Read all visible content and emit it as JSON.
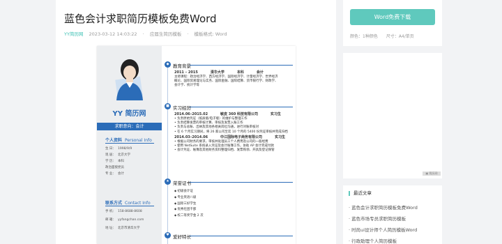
{
  "article": {
    "title": "蓝色会计求职简历模板免费Word",
    "site": "YY简历网",
    "date": "2023-03-12 14:03:22",
    "category": "应届生简历模板",
    "format": "模板格式: Word"
  },
  "resume": {
    "name": "YY 简历网",
    "intent": "求职意向：会计",
    "personal_title": "个人资料",
    "personal_en": "Personal Info",
    "personal": [
      {
        "k": "生    日：",
        "v": "1998/9/9"
      },
      {
        "k": "现    居：",
        "v": "北京大学"
      },
      {
        "k": "学    历：",
        "v": "本科"
      },
      {
        "k": "政治面貌：",
        "v": "党员"
      },
      {
        "k": "专    业：",
        "v": "会计"
      }
    ],
    "contact_title": "联系方式",
    "contact_en": "Contact Info",
    "contact": [
      {
        "k": "手    机：",
        "v": "158-8688-8608"
      },
      {
        "k": "邮    箱：",
        "v": "yyfangchan.com"
      },
      {
        "k": "地    址：",
        "v": "北京市清华大学"
      }
    ],
    "edu_title": "教育背景",
    "edu_period": "2011 – 2015",
    "edu_school": "清华大学",
    "edu_degree": "本科",
    "edu_major": "会计",
    "edu_desc": [
      "主修课程：政治经济学、西方经济学、国际经济学、计量经济学、世界经济",
      "概论、国际贸易理论与实务、国际金融、国际结算、货币银行学、财政学、",
      "会计学、统计学等"
    ],
    "work_title": "实习经历",
    "job1_period": "2014.06–2015.02",
    "job1_company": "敏皮 360 科技有限公司",
    "job1_role": "实习生",
    "job1_items": [
      "负责原始凭证（纸质版/电子版）的维护与整理工作",
      "负责结算发票的审核计算、审核及发票入账工作",
      "负责与总账、出纳及其他各相关岗位沟通，进行对账审核对",
      "在 6 个月实习期间，将 26 家公司至迄 10 个月的 5400 份凭证审核并完成归档"
    ],
    "job2_period": "2014.03–2014.06",
    "job2_company": "中江国际电子商务有限公司",
    "job2_role": "实习生",
    "job2_items": [
      "根据公司财务的要求，审核并处理员工个人费用及公司的一般经费",
      "使用 NetSuite 系统录入凭证及会计账簿工作，协助 AP 会计完成付款",
      "会计凭证、账簿及其他财务资料整理归档、发票购领、开具及登记保管"
    ],
    "cert_title": "荣誉证书",
    "certs": [
      "初级会计证",
      "专业英语八级",
      "国际三好学生",
      "优秀社团干部",
      "校二等奖学金 2 次"
    ],
    "hobby_title": "爱好特长"
  },
  "sidebar": {
    "download_label": "Word免费下载",
    "color_spec": "颜色：1种颜色",
    "size_spec": "尺寸：A4/单页",
    "watermark": "▣ 简历网",
    "recent_title": "最近文章",
    "recent": [
      "蓝色会计求职简历模板免费Word",
      "蓝色市场专员求职简历模板",
      "时尚ui设计师个人简历模板Word",
      "行政助理个人简历模板"
    ]
  },
  "colors": {
    "accent": "#2b6cb8",
    "brand": "#5fc9bd"
  }
}
